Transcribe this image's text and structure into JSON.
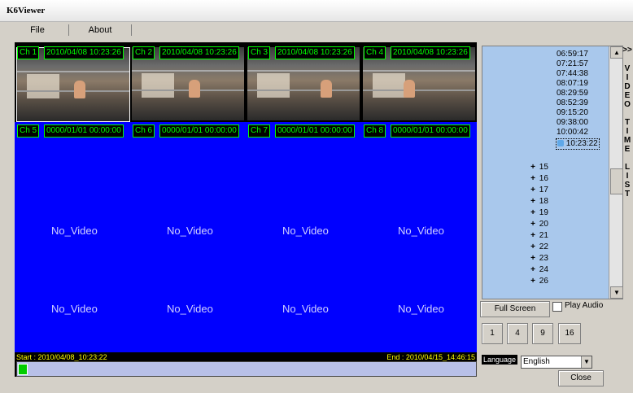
{
  "window": {
    "title": "K6Viewer"
  },
  "menu": {
    "items": [
      "File",
      "About"
    ]
  },
  "channels": [
    {
      "label": "Ch 1",
      "time": "2010/04/08 10:23:26"
    },
    {
      "label": "Ch 2",
      "time": "2010/04/08 10:23:26"
    },
    {
      "label": "Ch 3",
      "time": "2010/04/08 10:23:26"
    },
    {
      "label": "Ch 4",
      "time": "2010/04/08 10:23:26"
    },
    {
      "label": "Ch 5",
      "time": "0000/01/01 00:00:00"
    },
    {
      "label": "Ch 6",
      "time": "0000/01/01 00:00:00"
    },
    {
      "label": "Ch 7",
      "time": "0000/01/01 00:00:00"
    },
    {
      "label": "Ch 8",
      "time": "0000/01/01 00:00:00"
    }
  ],
  "no_video_text": "No_Video",
  "timeline": {
    "start": "Start : 2010/04/08_10:23:22",
    "end": "End : 2010/04/15_14:46:15"
  },
  "tree": {
    "times": [
      "06:59:17",
      "07:21:57",
      "07:44:38",
      "08:07:19",
      "08:29:59",
      "08:52:39",
      "09:15:20",
      "09:38:00",
      "10:00:42",
      "10:23:22"
    ],
    "selected_time": "10:23:22",
    "dates": [
      "15",
      "16",
      "17",
      "18",
      "19",
      "20",
      "21",
      "22",
      "23",
      "24",
      "26"
    ]
  },
  "side_tab": {
    "toggle": ">>",
    "letters": [
      "V",
      "I",
      "D",
      "E",
      "O",
      "",
      "T",
      "I",
      "M",
      "E",
      "",
      "L",
      "I",
      "S",
      "T"
    ]
  },
  "controls": {
    "full_screen": "Full Screen",
    "play_audio": "Play Audio",
    "split_buttons": [
      "1",
      "4",
      "9",
      "16"
    ],
    "language_label": "Language",
    "language_value": "English",
    "close": "Close"
  }
}
